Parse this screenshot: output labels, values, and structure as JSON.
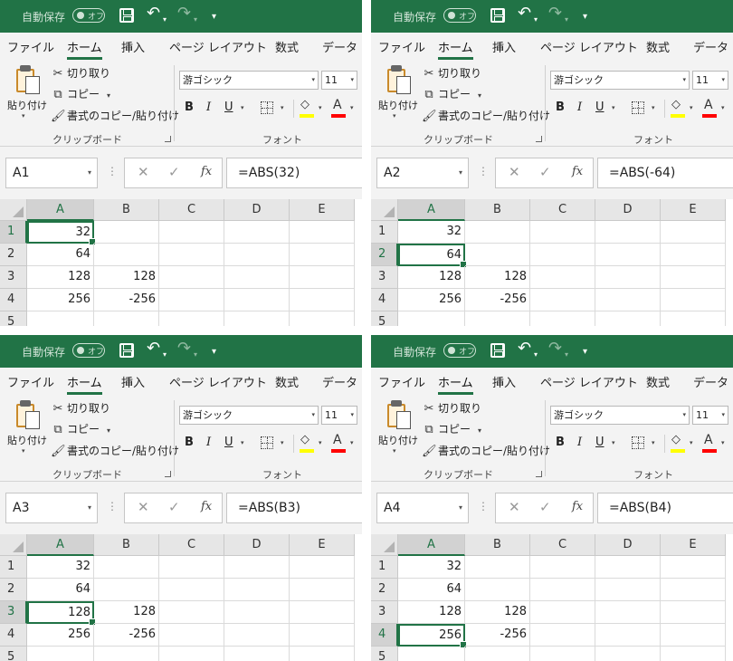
{
  "ribbon": {
    "autosave_label": "自動保存",
    "autosave_toggle": "オフ",
    "tabs": [
      "ファイル",
      "ホーム",
      "挿入",
      "ページ レイアウト",
      "数式",
      "データ"
    ],
    "active_tab": "ホーム",
    "paste_label": "貼り付け",
    "cut_label": "切り取り",
    "copy_label": "コピー",
    "format_painter_label": "書式のコピー/貼り付け",
    "clipboard_group": "クリップボード",
    "font_group": "フォント",
    "font_name": "游ゴシック",
    "font_size": "11",
    "bold": "B",
    "italic": "I",
    "underline": "U",
    "font_color_letter": "A",
    "fill_color": "#ffff00",
    "font_color": "#ff0000",
    "accent_color": "#217346"
  },
  "sheet": {
    "columns": [
      "A",
      "B",
      "C",
      "D",
      "E"
    ],
    "rows": [
      "1",
      "2",
      "3",
      "4",
      "5"
    ],
    "cells": [
      [
        "32",
        ""
      ],
      [
        "64",
        ""
      ],
      [
        "128",
        "128"
      ],
      [
        "256",
        "-256"
      ],
      [
        "",
        ""
      ]
    ]
  },
  "panels": [
    {
      "namebox": "A1",
      "formula": "=ABS(32)",
      "selected_row": 1
    },
    {
      "namebox": "A2",
      "formula": "=ABS(-64)",
      "selected_row": 2
    },
    {
      "namebox": "A3",
      "formula": "=ABS(B3)",
      "selected_row": 3
    },
    {
      "namebox": "A4",
      "formula": "=ABS(B4)",
      "selected_row": 4
    }
  ]
}
